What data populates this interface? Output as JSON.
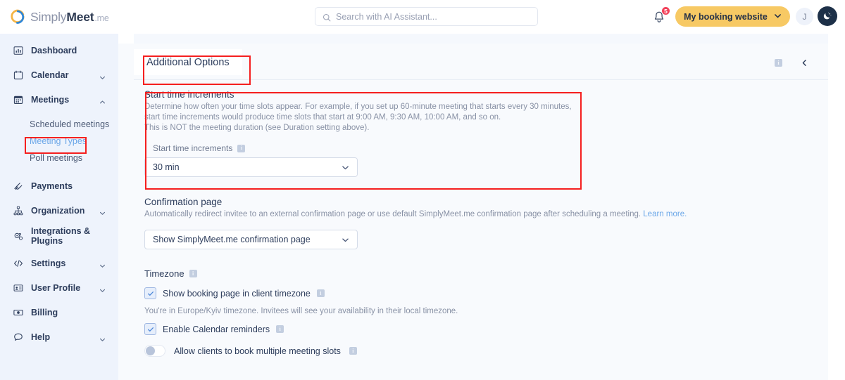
{
  "brand": {
    "name_part1": "Simply",
    "name_part2": "Meet",
    "name_suffix": ".me",
    "accent_blue": "#2f86d6",
    "accent_orange": "#f5b544"
  },
  "topbar": {
    "search": {
      "placeholder": "Search with AI Assistant...",
      "icon": "search-icon",
      "value": ""
    },
    "notifications": {
      "icon": "bell-icon",
      "count": "5"
    },
    "booking_button": {
      "label": "My booking website",
      "chevron": "chevron-down-icon",
      "color": "#f7c964"
    },
    "avatar": {
      "initial": "J"
    },
    "theme_toggle": {
      "icon": "moon-icon",
      "color": "#1d3048"
    }
  },
  "sidebar": {
    "items": [
      {
        "label": "Dashboard",
        "icon": "chart-bar-icon",
        "chevron": false
      },
      {
        "label": "Calendar",
        "icon": "calendar-icon",
        "chevron": true,
        "expanded": false
      },
      {
        "label": "Meetings",
        "icon": "calendar-days-icon",
        "chevron": true,
        "expanded": true
      },
      {
        "label": "Payments",
        "icon": "payments-icon",
        "chevron": false
      },
      {
        "label": "Organization",
        "icon": "org-chart-icon",
        "chevron": true,
        "expanded": false
      },
      {
        "label": "Integrations & Plugins",
        "icon": "plugins-icon",
        "chevron": false
      },
      {
        "label": "Settings",
        "icon": "code-icon",
        "chevron": true,
        "expanded": false
      },
      {
        "label": "User Profile",
        "icon": "id-card-icon",
        "chevron": true,
        "expanded": false
      },
      {
        "label": "Billing",
        "icon": "banknote-icon",
        "chevron": false
      },
      {
        "label": "Help",
        "icon": "chat-bubble-icon",
        "chevron": true,
        "expanded": false
      }
    ],
    "meetings_sub": [
      {
        "label": "Scheduled meetings",
        "active": false
      },
      {
        "label": "Meeting Types",
        "active": true
      },
      {
        "label": "Poll meetings",
        "active": false
      }
    ]
  },
  "main": {
    "tab_label": "Additional Options",
    "header_info_icon": "info-icon",
    "header_collapse_icon": "chevron-left-icon",
    "start_time_increments": {
      "title": "Start time increments",
      "desc_line1": "Determine how often your time slots appear. For example, if you set up 60-minute meeting that starts every 30 minutes,",
      "desc_line2": "start time increments would produce time slots that start at 9:00 AM, 9:30 AM, 10:00 AM, and so on.",
      "desc_line3": "This is NOT the meeting duration (see Duration setting above).",
      "field_label": "Start time increments",
      "field_info_icon": "info-icon",
      "selected_value": "30 min",
      "chevron": "chevron-down-icon"
    },
    "confirmation_page": {
      "title": "Confirmation page",
      "desc": "Automatically redirect invitee to an external confirmation page or use default SimplyMeet.me confirmation page after scheduling a meeting.",
      "link_text": "Learn more.",
      "selected_value": "Show SimplyMeet.me confirmation page",
      "chevron": "chevron-down-icon"
    },
    "timezone": {
      "title": "Timezone",
      "title_info_icon": "info-icon",
      "client_tz_label": "Show booking page in client timezone",
      "client_tz_info_icon": "info-icon",
      "client_tz_checked": true,
      "tz_note": "You're in Europe/Kyiv timezone. Invitees will see your availability in their local timezone.",
      "cal_reminders_label": "Enable Calendar reminders",
      "cal_reminders_info_icon": "info-icon",
      "cal_reminders_checked": true,
      "multi_slots_label": "Allow clients to book multiple meeting slots",
      "multi_slots_info_icon": "info-icon",
      "multi_slots_on": false
    }
  },
  "annotations": {
    "color": "#f51f1f",
    "boxes": [
      "meeting-types-sidebar-item",
      "additional-options-tab",
      "start-time-increments-section"
    ]
  }
}
